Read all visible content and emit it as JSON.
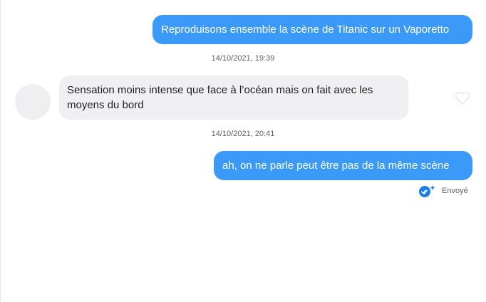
{
  "messages": [
    {
      "text": "Reproduisons ensemble la scène de Titanic sur un Vaporetto"
    },
    {
      "timestamp": "14/10/2021, 19:39"
    },
    {
      "text": "Sensation moins intense que face à l’océan mais on fait avec les moyens du bord"
    },
    {
      "timestamp": "14/10/2021, 20:41"
    },
    {
      "text": "ah, on ne parle peut être pas de la même scène"
    }
  ],
  "status": {
    "label": "Envoyé",
    "icon": "sent-check-icon"
  },
  "icons": {
    "like": "heart-icon"
  },
  "colors": {
    "outgoing_bubble": "#3b9af8",
    "incoming_bubble": "#f0f0f2",
    "check": "#1a7de8"
  }
}
